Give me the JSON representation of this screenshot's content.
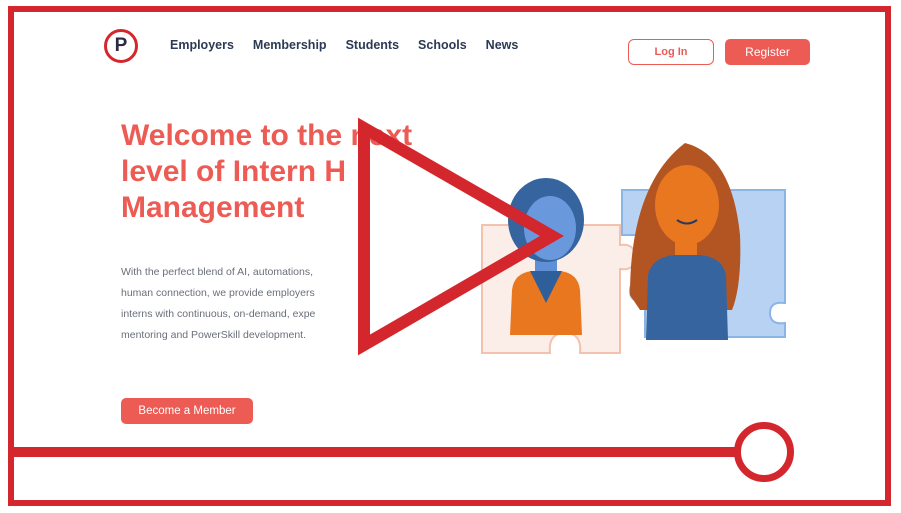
{
  "logo": {
    "letter": "P",
    "accent": "#d4262d"
  },
  "nav": {
    "items": [
      "Employers",
      "Membership",
      "Students",
      "Schools",
      "News"
    ]
  },
  "auth": {
    "login_label": "Log In",
    "register_label": "Register"
  },
  "hero": {
    "title_line1": "Welcome to the next",
    "title_line2": "level of Intern H",
    "title_line3": "Management",
    "body_line1": "With the perfect blend of AI, automations,",
    "body_line2": "human connection, we provide employers",
    "body_line3": "interns with continuous, on-demand, expe",
    "body_line4": "mentoring and PowerSkill development.",
    "cta_label": "Become a Member"
  },
  "video": {
    "state": "paused",
    "play_icon": "play-icon",
    "progress": 0.88
  },
  "colors": {
    "brand": "#ec5b54",
    "overlay_red": "#d4262d",
    "nav_text": "#2c3a55",
    "body_text": "#6a6f7a"
  }
}
